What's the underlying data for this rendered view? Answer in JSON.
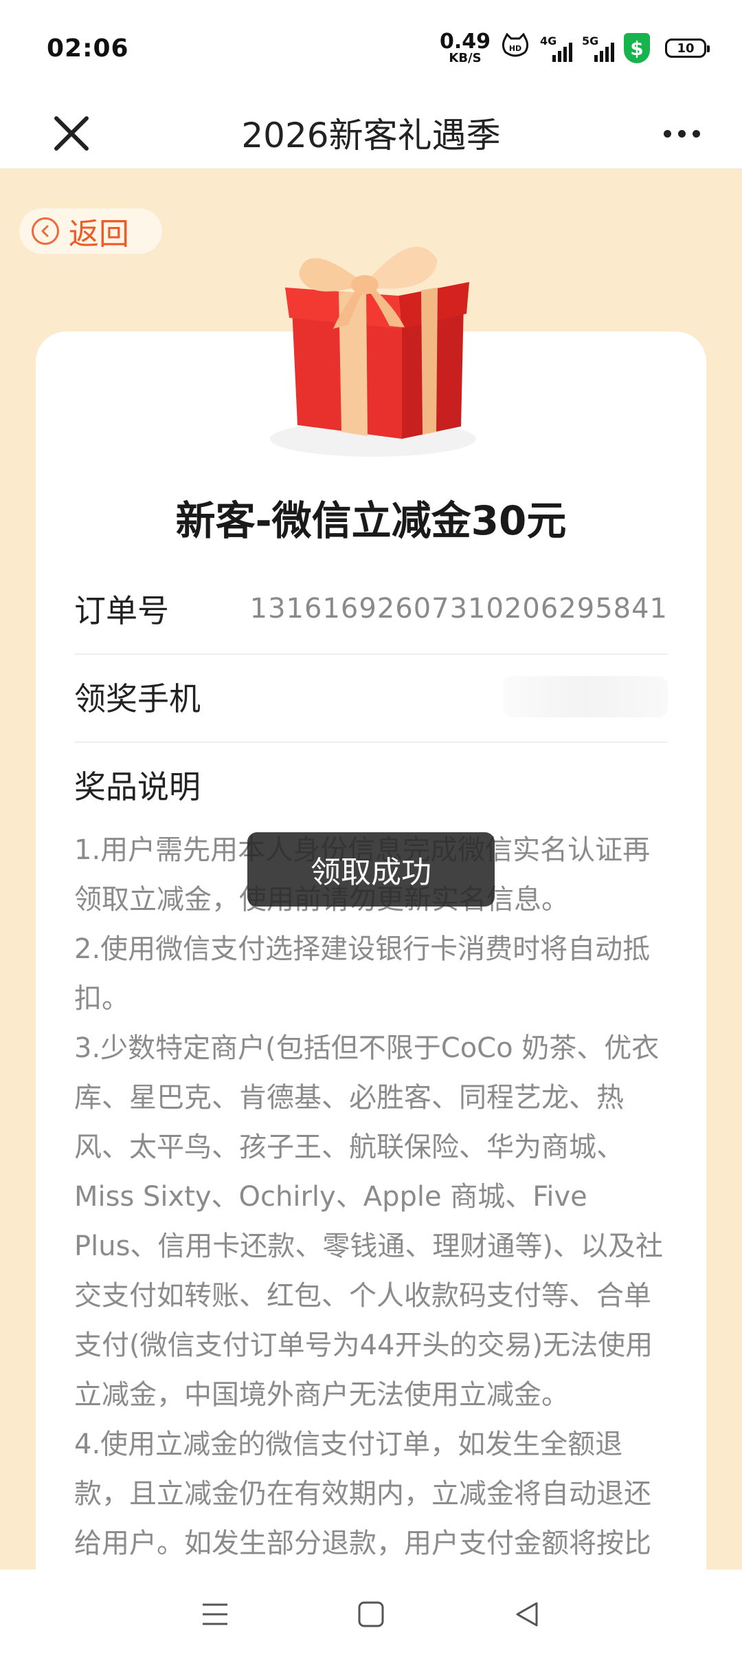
{
  "status_bar": {
    "time": "02:06",
    "net_speed_value": "0.49",
    "net_speed_unit": "KB/S",
    "signal1_tag": "4G",
    "signal2_tag": "5G",
    "battery_level": "10"
  },
  "header": {
    "title": "2026新客礼遇季"
  },
  "back": {
    "label": "返回"
  },
  "prize": {
    "title": "新客-微信立减金30元"
  },
  "info": {
    "order_label": "订单号",
    "order_value": "131616926073102062958​41",
    "phone_label": "领奖手机",
    "desc_label": "奖品说明"
  },
  "description": [
    "1.用户需先用本人身份信息完成微信实名认证再领取立减金，使用前请勿更新实名信息。",
    "2.使用微信支付选择建设银行卡消费时将自动抵扣。",
    "3.少数特定商户(包括但不限于CoCo 奶茶、优衣库、星巴克、肯德基、必胜客、同程艺龙、热风、太平鸟、孩子王、航联保险、华为商城、Miss Sixty、Ochirly、Apple 商城、Five Plus、信用卡还款、零钱通、理财通等)、以及社交支付如转账、红包、个人收款码支付等、合单支付(微信支付订单号为44开头的交易)无法使用立减金，中国境外商户无法使用立减金。",
    "4.使用立减金的微信支付订单，如发生全额退款，且立减金仍在有效期内，立减金将自动退还给用户。如发生部分退款，用户支付金额将按比"
  ],
  "toast": {
    "message": "领取成功"
  },
  "colors": {
    "page_bg": "#fbeacc",
    "accent": "#ef5b27",
    "gift_red": "#e8302c",
    "ribbon": "#f8c99a"
  }
}
